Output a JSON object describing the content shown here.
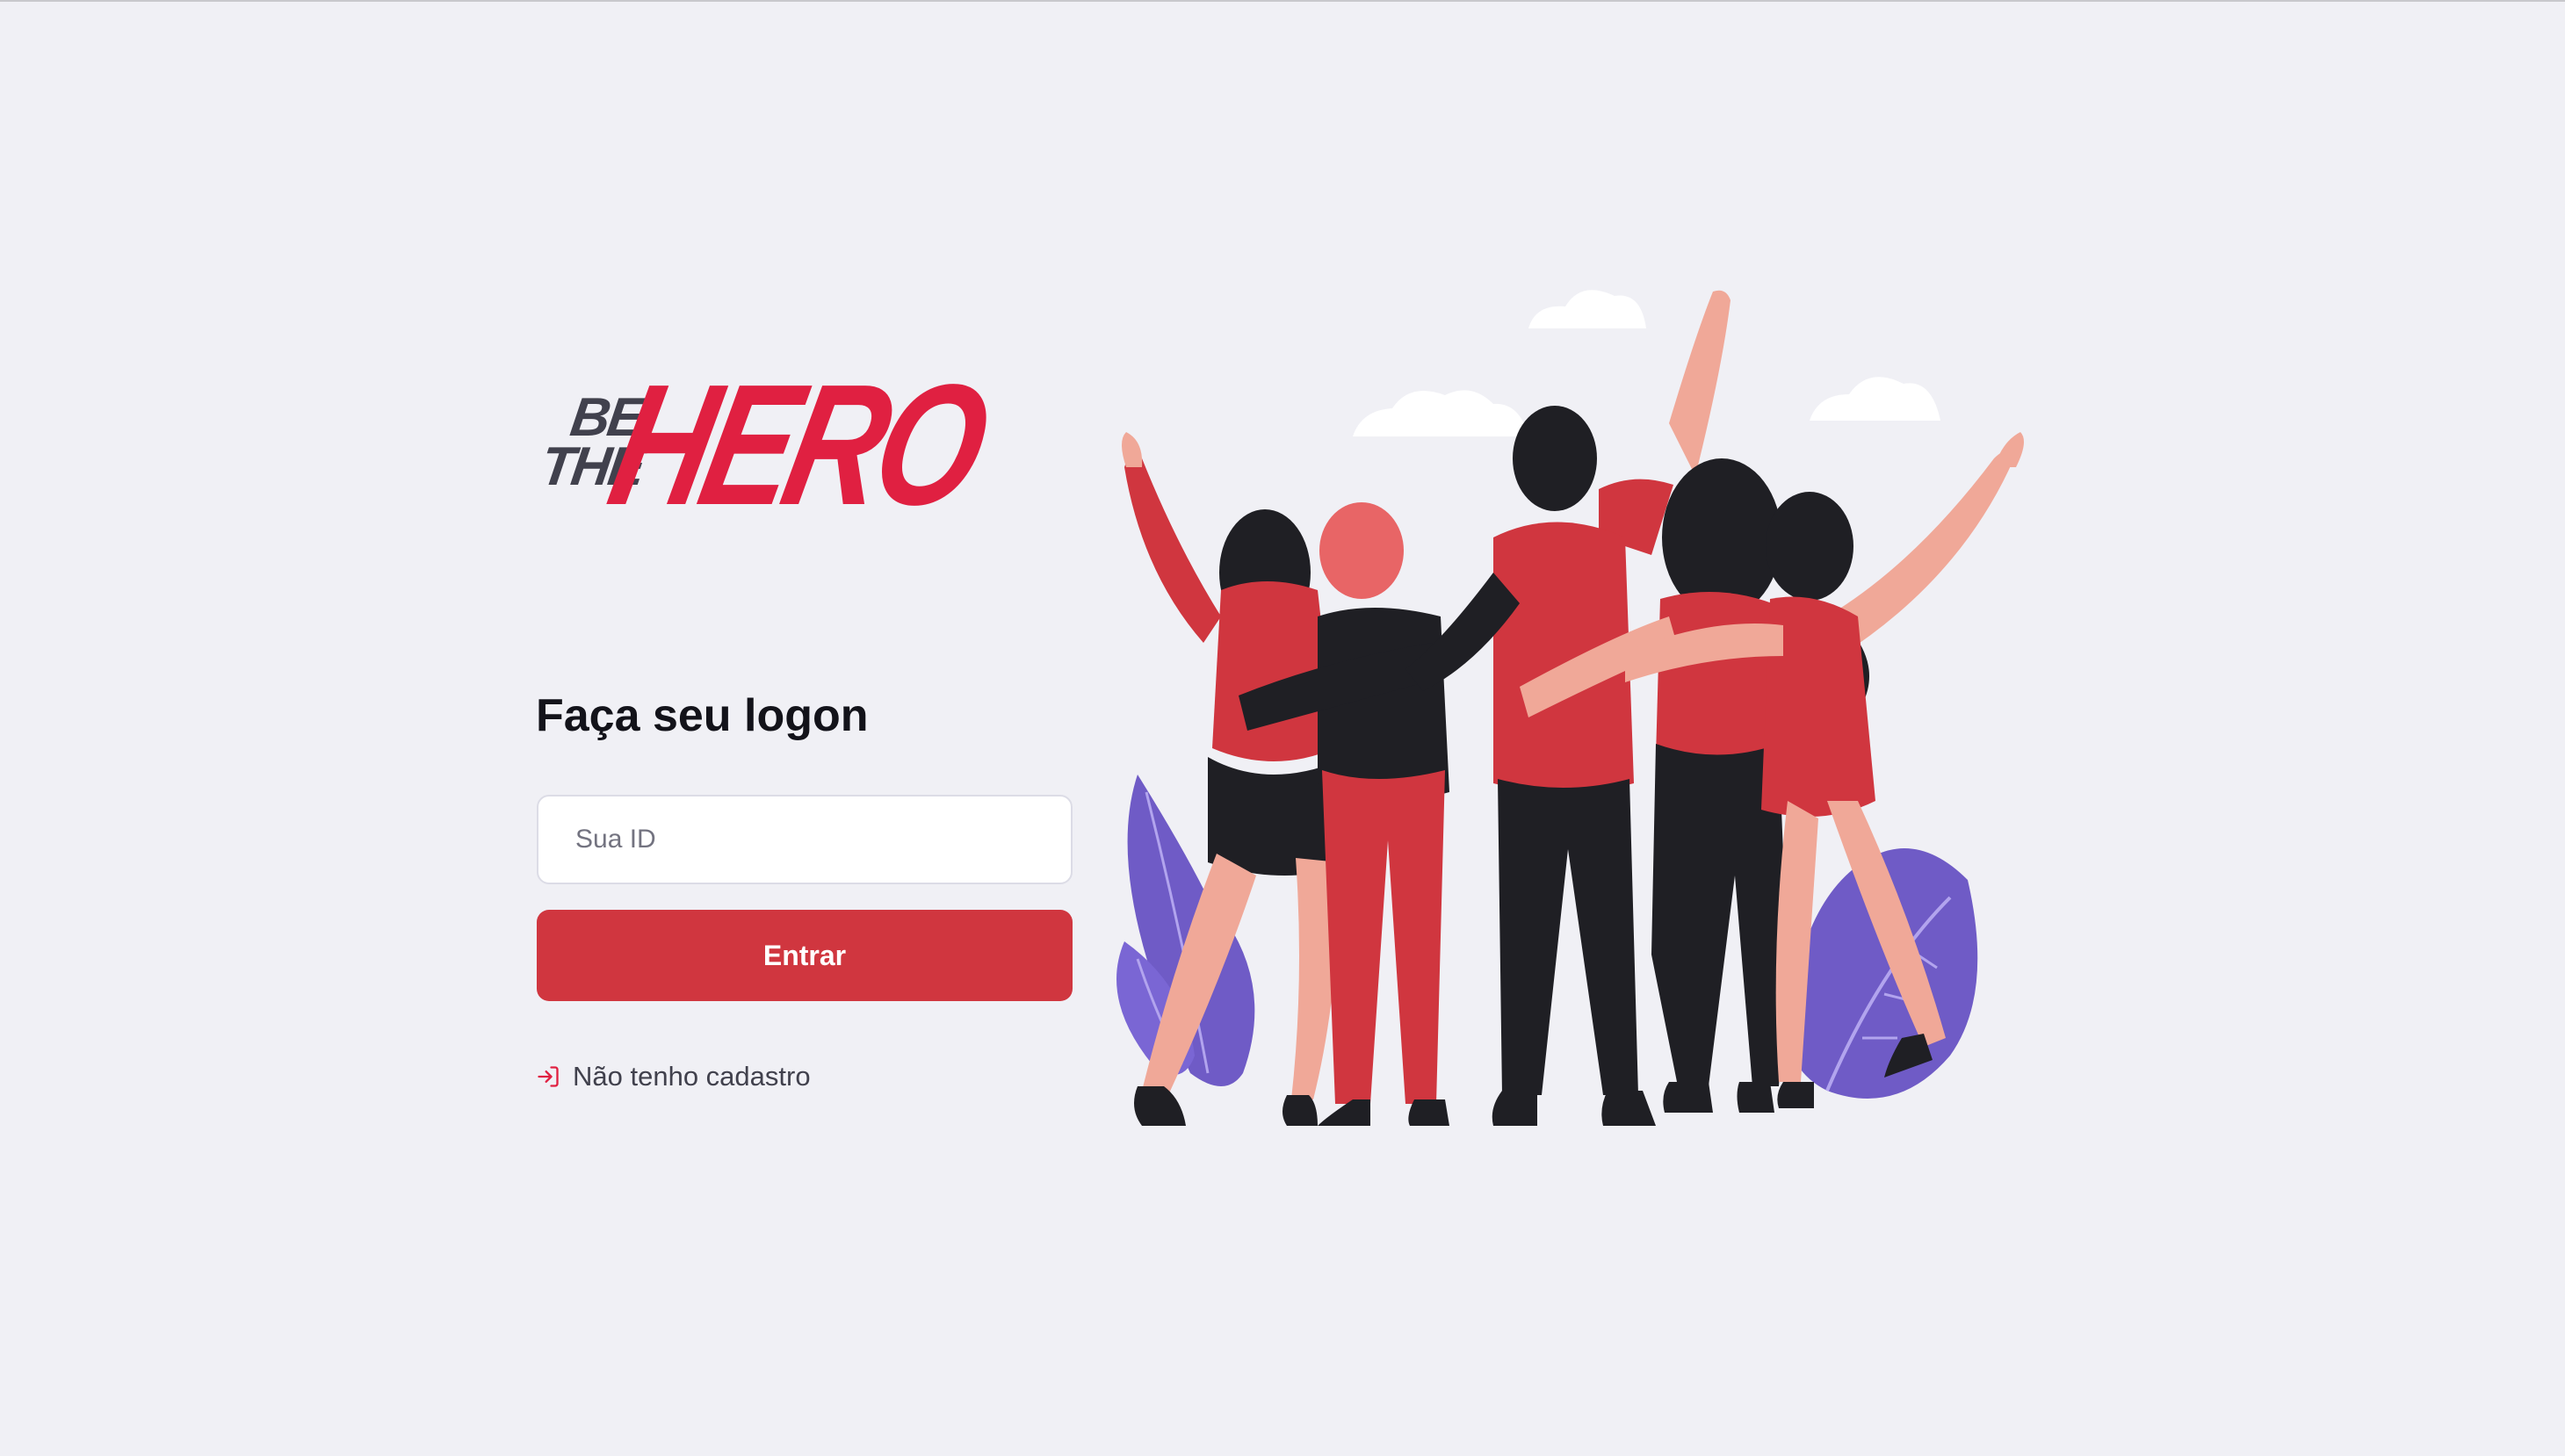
{
  "brand": {
    "logo_be": "BE",
    "logo_the": "THE",
    "logo_hero": "HERO"
  },
  "logon": {
    "title": "Faça seu logon",
    "id_placeholder": "Sua ID",
    "id_value": "",
    "submit_label": "Entrar",
    "register_label": "Não tenho cadastro",
    "register_icon": "log-in-icon"
  },
  "illustration": {
    "name": "heroes-illustration"
  },
  "colors": {
    "background": "#f0f0f5",
    "brand_red": "#e02041",
    "button_red": "#d0363f",
    "dark_text": "#41414d"
  }
}
